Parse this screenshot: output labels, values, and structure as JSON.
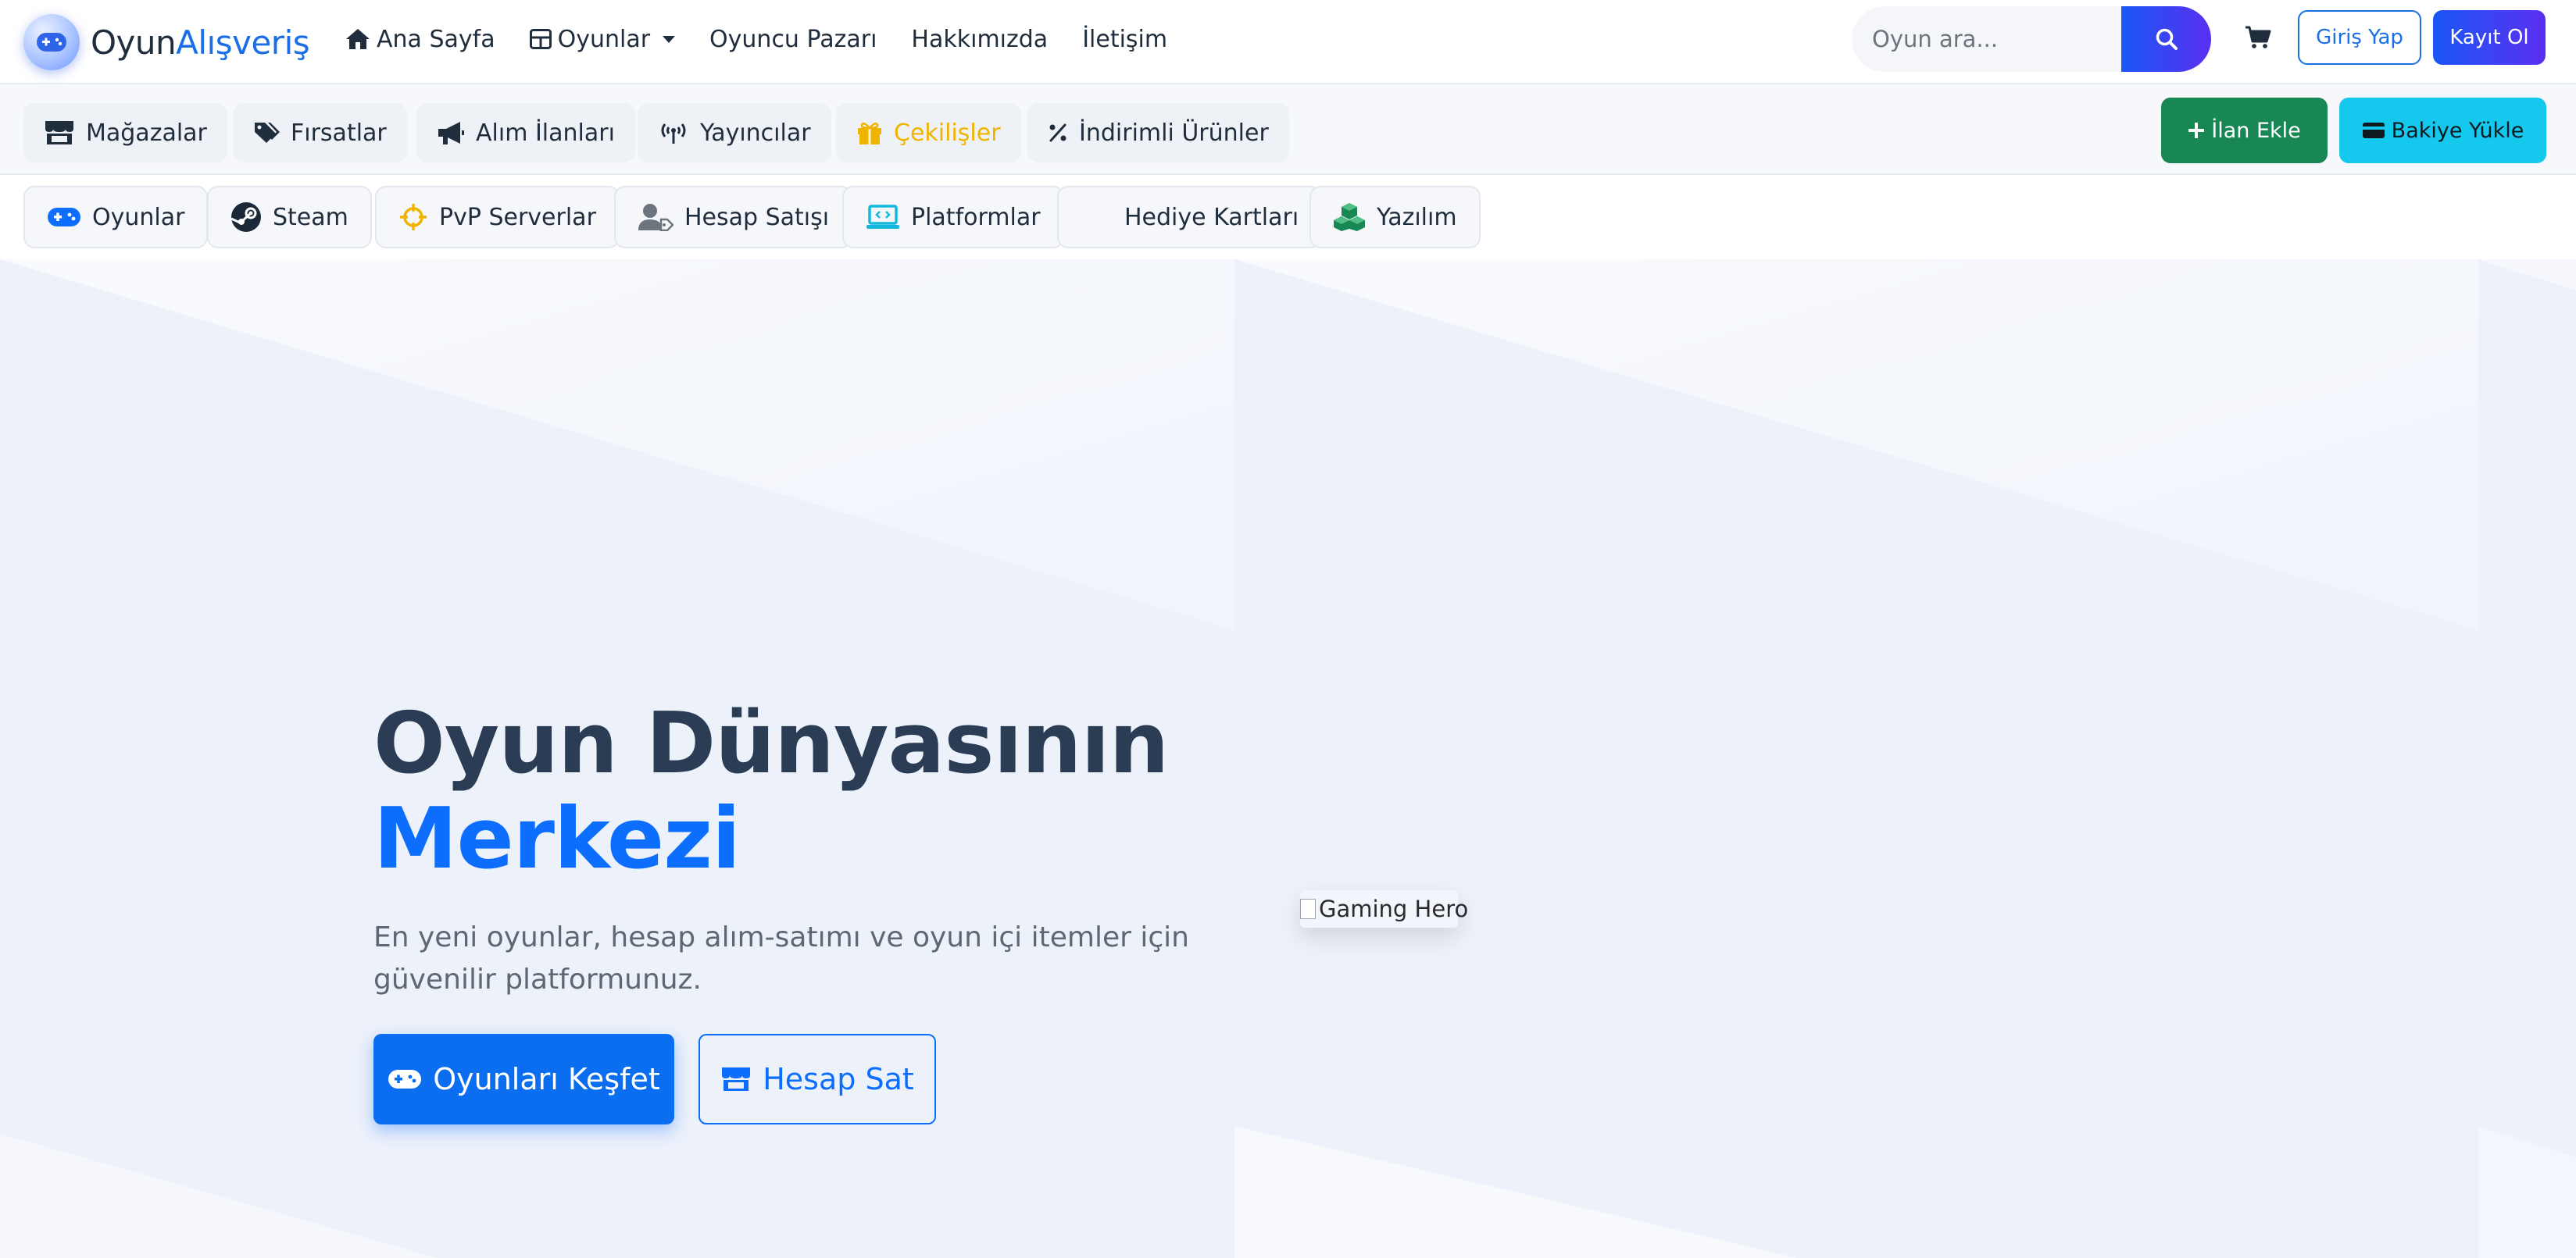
{
  "brand": {
    "part1": "Oyun",
    "part2": "Alışveriş"
  },
  "nav": {
    "home": "Ana Sayfa",
    "games": "Oyunlar",
    "player_market": "Oyuncu Pazarı",
    "about": "Hakkımızda",
    "contact": "İletişim"
  },
  "search": {
    "placeholder": "Oyun ara..."
  },
  "auth": {
    "login": "Giriş Yap",
    "register": "Kayıt Ol"
  },
  "subnav": {
    "stores": "Mağazalar",
    "deals": "Fırsatlar",
    "purchase_ads": "Alım İlanları",
    "streamers": "Yayıncılar",
    "giveaways": "Çekilişler",
    "discounted": "İndirimli Ürünler",
    "add_listing": "İlan Ekle",
    "top_up": "Bakiye Yükle"
  },
  "categories": {
    "games": "Oyunlar",
    "steam": "Steam",
    "pvp": "PvP Serverlar",
    "account_sales": "Hesap Satışı",
    "platforms": "Platformlar",
    "gift_cards": "Hediye Kartları",
    "software": "Yazılım"
  },
  "hero": {
    "title_line1": "Oyun Dünyasının",
    "title_line2": "Merkezi",
    "subtitle": "En yeni oyunlar, hesap alım-satımı ve oyun içi itemler için güvenilir platformunuz.",
    "cta_primary": "Oyunları Keşfet",
    "cta_secondary": "Hesap Sat",
    "image_alt": "Gaming Hero"
  },
  "colors": {
    "accent": "#0d6efd",
    "success": "#198754",
    "info": "#14c8ee",
    "warning": "#f0b400",
    "gradient_start": "#1a57f5",
    "gradient_end": "#5b2ff0"
  }
}
